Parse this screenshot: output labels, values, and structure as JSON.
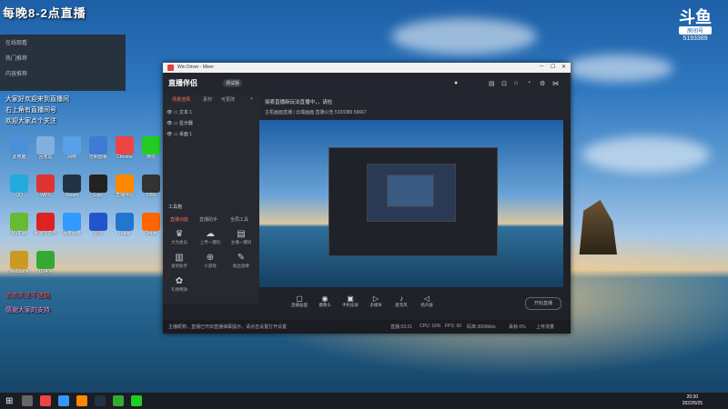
{
  "stream_title": "每晚8-2点直播",
  "menu_items": [
    "在线观看",
    "热门推荐",
    "内容推荐"
  ],
  "logo": {
    "mark": "斗鱼",
    "sub": "房间号",
    "room": "5193389"
  },
  "overlay_lines": [
    {
      "text": "大家好欢迎来到直播间",
      "color": "white"
    },
    {
      "text": "右上角有直播间号",
      "color": "white"
    },
    {
      "text": "欢迎大家点个关注",
      "color": "white"
    },
    {
      "text": "点点关注不迷路",
      "color": "red"
    },
    {
      "text": "感谢大家的支持",
      "color": "pink"
    }
  ],
  "desktop_icons": [
    {
      "label": "此电脑",
      "color": "#4a90d9"
    },
    {
      "label": "回收站",
      "color": "#7fb0e0"
    },
    {
      "label": "网络",
      "color": "#5aa0e8"
    },
    {
      "label": "控制面板",
      "color": "#3d7bd4"
    },
    {
      "label": "Chrome",
      "color": "#e44"
    },
    {
      "label": "微信",
      "color": "#2c2"
    },
    {
      "label": "QQ",
      "color": "#2ad"
    },
    {
      "label": "WPS",
      "color": "#d33"
    },
    {
      "label": "Steam",
      "color": "#234"
    },
    {
      "label": "Epic",
      "color": "#222"
    },
    {
      "label": "直播伴侣",
      "color": "#f80"
    },
    {
      "label": "OBS",
      "color": "#333"
    },
    {
      "label": "NVIDIA",
      "color": "#6b3"
    },
    {
      "label": "网易云音乐",
      "color": "#d22"
    },
    {
      "label": "百度网盘",
      "color": "#39f"
    },
    {
      "label": "迅雷",
      "color": "#25c"
    },
    {
      "label": "Uplay",
      "color": "#27c"
    },
    {
      "label": "Origin",
      "color": "#f60"
    },
    {
      "label": "WeGame",
      "color": "#c92"
    },
    {
      "label": "GTA V",
      "color": "#3a3"
    }
  ],
  "window": {
    "title": "Win Driver - Mixer",
    "app_name": "直播伴侣",
    "version": "测试版",
    "source_tabs": [
      "场景选择",
      "素材",
      "可更改"
    ],
    "scenes": [
      "文本 1",
      "显示器",
      "桌面 1"
    ],
    "tools_title": "工具箱",
    "tools_tabs": [
      "直播功能",
      "直播助手",
      "全局工具"
    ],
    "tools": [
      "大为会员",
      "上传一键码",
      "主播一键码",
      "发奖助手",
      "小游戏",
      "粉丝勋章",
      "礼物特效"
    ],
    "info_line1": "探索直播新玩法直播中，，请检",
    "info_line2": "主机画面直播 | 云端画面  直播公告  5193389  59667",
    "bottom_controls": [
      {
        "icon": "▢",
        "label": "直播画面"
      },
      {
        "icon": "◉",
        "label": "摄像头"
      },
      {
        "icon": "▣",
        "label": "手机投屏"
      },
      {
        "icon": "▷",
        "label": "多媒体"
      },
      {
        "icon": "♪",
        "label": "麦克风"
      },
      {
        "icon": "◁",
        "label": "扬声器"
      }
    ],
    "start_label": "开始直播",
    "status_left": "主播昵称，直播已开启直播弹幕提示，请点击设置打开设置",
    "status_items": [
      "直播 03:21",
      "CPU: 16%",
      "FPS: 60",
      "码率:3000kb/s",
      "丢帧 0%",
      "上传流量"
    ]
  },
  "taskbar": {
    "time": "20:30",
    "date": "2022/5/25"
  }
}
